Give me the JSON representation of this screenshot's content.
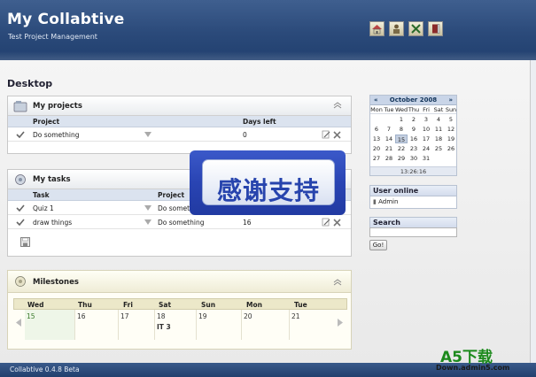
{
  "header": {
    "title": "My Collabtive",
    "subtitle": "Test Project Management",
    "icons": [
      "home-icon",
      "user-icon",
      "admin-icon",
      "logout-icon"
    ]
  },
  "page": {
    "title": "Desktop"
  },
  "projects": {
    "title": "My projects",
    "columns": [
      "Project",
      "Days left"
    ],
    "rows": [
      {
        "name": "Do something",
        "days_left": "0"
      }
    ]
  },
  "tasks": {
    "title": "My tasks",
    "columns": [
      "Task",
      "Project"
    ],
    "rows": [
      {
        "name": "Quiz 1",
        "project": "Do someth",
        "days_left": ""
      },
      {
        "name": "draw things",
        "project": "Do something",
        "days_left": "16"
      }
    ]
  },
  "milestones": {
    "title": "Milestones",
    "days": [
      "Wed",
      "Thu",
      "Fri",
      "Sat",
      "Sun",
      "Mon",
      "Tue"
    ],
    "dates": [
      "15",
      "16",
      "17",
      "18",
      "19",
      "20",
      "21"
    ],
    "event": {
      "day_index": 3,
      "label": "IT 3"
    }
  },
  "calendar": {
    "month": "October 2008",
    "prev": "«",
    "next": "»",
    "weekdays": [
      "Mon",
      "Tue",
      "Wed",
      "Thu",
      "Fri",
      "Sat",
      "Sun"
    ],
    "weeks": [
      [
        "",
        "",
        "1",
        "2",
        "3",
        "4",
        "5"
      ],
      [
        "6",
        "7",
        "8",
        "9",
        "10",
        "11",
        "12"
      ],
      [
        "13",
        "14",
        "15",
        "16",
        "17",
        "18",
        "19"
      ],
      [
        "20",
        "21",
        "22",
        "23",
        "24",
        "25",
        "26"
      ],
      [
        "27",
        "28",
        "29",
        "30",
        "31",
        "",
        ""
      ]
    ],
    "today": "15",
    "time": "13:26:16"
  },
  "user_online": {
    "title": "User online",
    "users": [
      "Admin"
    ]
  },
  "search": {
    "title": "Search",
    "value": "",
    "button": "Go!"
  },
  "overlay": {
    "text": "感谢支持"
  },
  "footer": {
    "version": "Collabtive 0.4.8 Beta"
  },
  "watermark": {
    "brand": "A5下载",
    "url": "Down.admin5.com"
  },
  "colors": {
    "header": "#2b4a7a",
    "accent": "#2744ad",
    "panel_head": "#dbe3ef"
  }
}
